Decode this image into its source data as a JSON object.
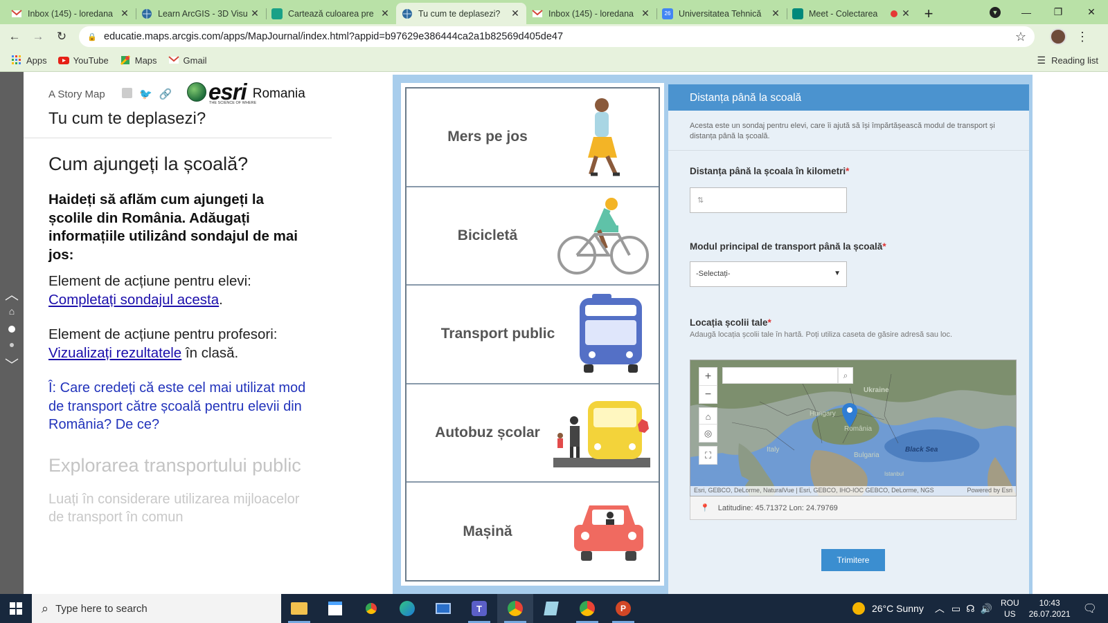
{
  "browser": {
    "tabs": [
      {
        "title": "Inbox (145) - loredana",
        "icon": "gmail-icon",
        "color": "#d44638"
      },
      {
        "title": "Learn ArcGIS - 3D Visu",
        "icon": "arcgis-globe-icon",
        "color": "#2d6a9f"
      },
      {
        "title": "Carteazǎ culoarea pre",
        "icon": "storymap-icon",
        "color": "#1aa187"
      },
      {
        "title": "Tu cum te deplasezi?",
        "icon": "arcgis-globe-icon",
        "color": "#2d6a9f"
      },
      {
        "title": "Inbox (145) - loredana",
        "icon": "gmail-icon",
        "color": "#d44638"
      },
      {
        "title": "Universitatea Tehnicǎ",
        "icon": "calendar-icon",
        "color": "#4285f4"
      },
      {
        "title": "Meet - Colectarea",
        "icon": "meet-icon",
        "color": "#00897b"
      }
    ],
    "active_tab_index": 3,
    "url": "educatie.maps.arcgis.com/apps/MapJournal/index.html?appid=b97629e386444ca2a1b82569d405de47",
    "bookmarks": [
      {
        "label": "Apps",
        "icon": "apps-grid-icon"
      },
      {
        "label": "YouTube",
        "icon": "youtube-icon"
      },
      {
        "label": "Maps",
        "icon": "maps-icon"
      },
      {
        "label": "Gmail",
        "icon": "gmail-icon"
      }
    ],
    "reading_list": "Reading list"
  },
  "story": {
    "brand_small": "A Story Map",
    "esri_word": "esri",
    "esri_tagline": "THE SCIENCE OF WHERE",
    "esri_region": "Romania",
    "title": "Tu cum te deplasezi?",
    "section_title": "Cum ajungeți la școală?",
    "lead": "Haideți să aflăm cum ajungeți la școlile din România. Adăugați informațiile utilizând sondajul de mai jos:",
    "students_prefix": "Element de acțiune pentru elevi:",
    "students_link": "Completați sondajul acesta",
    "students_suffix": ".",
    "teachers_prefix": "Element de acțiune pentru profesori:",
    "teachers_link": "Vizualizați rezultatele",
    "teachers_suffix": " în clasă.",
    "question": "Î: Care credeți că este cel mai utilizat mod de transport către școală pentru elevii din România? De ce?",
    "next_section_title": "Explorarea transportului public",
    "next_para": "Luați în considerare utilizarea mijloacelor de transport în comun"
  },
  "transport_modes": [
    {
      "label": "Mers pe jos",
      "icon": "walking-person-icon"
    },
    {
      "label": "Bicicletă",
      "icon": "bicycle-icon"
    },
    {
      "label": "Transport public",
      "icon": "bus-icon"
    },
    {
      "label": "Autobuz școlar",
      "icon": "school-bus-icon"
    },
    {
      "label": "Mașină",
      "icon": "car-icon"
    }
  ],
  "survey": {
    "header": "Distanța până la scoală",
    "description": "Acesta este un sondaj pentru elevi, care îi ajută să își împărtășească modul de transport și distanța până la școală.",
    "distance_label": "Distanța până la școala în kilometri",
    "distance_value": "",
    "transport_label": "Modul principal de transport până la școală",
    "transport_selected": "-Selectați-",
    "location_label": "Locația școlii tale",
    "location_hint": "Adaugă locația școlii tale în hartă. Poți utiliza caseta de găsire adresă sau loc.",
    "required_mark": "*",
    "map_labels": [
      "Ukraine",
      "Hungary",
      "România",
      "Italy",
      "Bulgaria",
      "Black Sea",
      "Istanbul"
    ],
    "attribution": "Esri, GEBCO, DeLorme, NaturalVue | Esri, GEBCO, IHO-IOC GEBCO, DeLorme, NGS",
    "powered_by": "Powered by Esri",
    "coords": "Latitudine: 45.71372  Lon: 24.79769",
    "submit": "Trimitere"
  },
  "taskbar": {
    "search_placeholder": "Type here to search",
    "weather": "26°C  Sunny",
    "lang": "ROU",
    "lang_sub": "US",
    "time": "10:43",
    "date": "26.07.2021"
  },
  "colors": {
    "tab_strip": "#b9e1a7",
    "toolbar": "#e7f2dd",
    "survey_header": "#4b93cf",
    "submit": "#3b8ed0",
    "link": "#1a0dab",
    "question": "#2233bb",
    "frame": "#a8cdec"
  }
}
